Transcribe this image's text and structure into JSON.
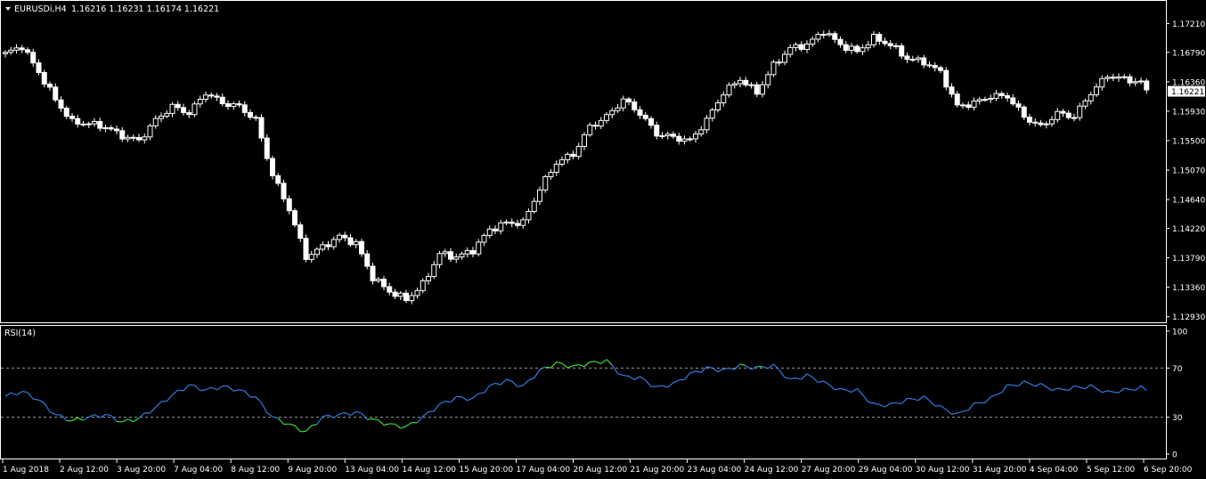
{
  "header": {
    "symbol_timeframe": "EURUSDi,H4",
    "ohlc": "1.16216 1.16231 1.16174 1.16221"
  },
  "colors": {
    "background": "#000000",
    "candle": "#ffffff",
    "grid_frame": "#ffffff",
    "rsi_line": "#2f7de1",
    "rsi_extreme": "#3ddc3d",
    "level_line": "#9a9a9a"
  },
  "chart_data": [
    {
      "type": "candlestick",
      "title": "EURUSDi,H4",
      "ylim": [
        1.129,
        1.1745
      ],
      "y_ticks": [
        "1.17210",
        "1.16790",
        "1.16360",
        "1.15930",
        "1.15500",
        "1.15070",
        "1.14640",
        "1.14220",
        "1.13790",
        "1.13360",
        "1.12930"
      ],
      "current_price_label": "1.16221",
      "x_tick_labels": [
        "1 Aug 2018",
        "2 Aug 12:00",
        "3 Aug 20:00",
        "7 Aug 04:00",
        "8 Aug 12:00",
        "9 Aug 20:00",
        "13 Aug 04:00",
        "14 Aug 12:00",
        "15 Aug 20:00",
        "17 Aug 04:00",
        "20 Aug 12:00",
        "21 Aug 20:00",
        "23 Aug 04:00",
        "24 Aug 12:00",
        "27 Aug 20:00",
        "29 Aug 04:00",
        "30 Aug 12:00",
        "31 Aug 20:00",
        "4 Sep 04:00",
        "5 Sep 12:00",
        "6 Sep 20:00"
      ],
      "anchors": [
        [
          0,
          1.1677
        ],
        [
          3,
          1.1688
        ],
        [
          6,
          1.165
        ],
        [
          9,
          1.161
        ],
        [
          12,
          1.1577
        ],
        [
          15,
          1.1575
        ],
        [
          18,
          1.157
        ],
        [
          21,
          1.1557
        ],
        [
          24,
          1.155
        ],
        [
          27,
          1.158
        ],
        [
          30,
          1.16
        ],
        [
          33,
          1.159
        ],
        [
          36,
          1.162
        ],
        [
          39,
          1.1605
        ],
        [
          42,
          1.16
        ],
        [
          45,
          1.158
        ],
        [
          48,
          1.15
        ],
        [
          51,
          1.145
        ],
        [
          54,
          1.138
        ],
        [
          57,
          1.1395
        ],
        [
          60,
          1.141
        ],
        [
          63,
          1.14
        ],
        [
          66,
          1.135
        ],
        [
          69,
          1.133
        ],
        [
          72,
          1.1318
        ],
        [
          75,
          1.134
        ],
        [
          78,
          1.1385
        ],
        [
          81,
          1.138
        ],
        [
          84,
          1.139
        ],
        [
          87,
          1.142
        ],
        [
          90,
          1.143
        ],
        [
          93,
          1.143
        ],
        [
          96,
          1.148
        ],
        [
          99,
          1.1518
        ],
        [
          102,
          1.153
        ],
        [
          105,
          1.157
        ],
        [
          108,
          1.1585
        ],
        [
          111,
          1.161
        ],
        [
          114,
          1.159
        ],
        [
          117,
          1.156
        ],
        [
          120,
          1.1555
        ],
        [
          123,
          1.155
        ],
        [
          126,
          1.158
        ],
        [
          129,
          1.162
        ],
        [
          132,
          1.164
        ],
        [
          135,
          1.162
        ],
        [
          138,
          1.166
        ],
        [
          141,
          1.1685
        ],
        [
          144,
          1.169
        ],
        [
          147,
          1.171
        ],
        [
          150,
          1.169
        ],
        [
          153,
          1.168
        ],
        [
          156,
          1.17
        ],
        [
          159,
          1.169
        ],
        [
          162,
          1.167
        ],
        [
          165,
          1.1665
        ],
        [
          168,
          1.165
        ],
        [
          171,
          1.16
        ],
        [
          174,
          1.1605
        ],
        [
          177,
          1.1615
        ],
        [
          180,
          1.1615
        ],
        [
          183,
          1.1585
        ],
        [
          186,
          1.157
        ],
        [
          189,
          1.159
        ],
        [
          192,
          1.1585
        ],
        [
          195,
          1.162
        ],
        [
          198,
          1.1645
        ],
        [
          201,
          1.164
        ],
        [
          204,
          1.1635
        ],
        [
          205,
          1.16221
        ]
      ]
    },
    {
      "type": "line",
      "title": "RSI(14)",
      "ylim": [
        0,
        100
      ],
      "y_ticks": [
        "100",
        "70",
        "30",
        "0"
      ],
      "levels": [
        70,
        30
      ],
      "anchors": [
        [
          0,
          47
        ],
        [
          3,
          51
        ],
        [
          6,
          44
        ],
        [
          9,
          32
        ],
        [
          12,
          27
        ],
        [
          15,
          30
        ],
        [
          18,
          32
        ],
        [
          21,
          26
        ],
        [
          24,
          29
        ],
        [
          27,
          38
        ],
        [
          30,
          48
        ],
        [
          33,
          56
        ],
        [
          36,
          52
        ],
        [
          39,
          55
        ],
        [
          42,
          52
        ],
        [
          45,
          46
        ],
        [
          48,
          30
        ],
        [
          51,
          24
        ],
        [
          54,
          18
        ],
        [
          57,
          30
        ],
        [
          60,
          32
        ],
        [
          63,
          34
        ],
        [
          66,
          28
        ],
        [
          69,
          24
        ],
        [
          72,
          22
        ],
        [
          75,
          30
        ],
        [
          78,
          40
        ],
        [
          81,
          46
        ],
        [
          84,
          45
        ],
        [
          87,
          55
        ],
        [
          90,
          60
        ],
        [
          93,
          55
        ],
        [
          96,
          68
        ],
        [
          99,
          74
        ],
        [
          102,
          71
        ],
        [
          105,
          74
        ],
        [
          108,
          76
        ],
        [
          111,
          63
        ],
        [
          114,
          62
        ],
        [
          117,
          54
        ],
        [
          120,
          57
        ],
        [
          123,
          65
        ],
        [
          126,
          70
        ],
        [
          129,
          68
        ],
        [
          132,
          72
        ],
        [
          135,
          70
        ],
        [
          138,
          72
        ],
        [
          141,
          60
        ],
        [
          144,
          64
        ],
        [
          147,
          58
        ],
        [
          150,
          52
        ],
        [
          153,
          52
        ],
        [
          156,
          40
        ],
        [
          159,
          40
        ],
        [
          162,
          44
        ],
        [
          165,
          46
        ],
        [
          168,
          38
        ],
        [
          171,
          32
        ],
        [
          174,
          40
        ],
        [
          177,
          45
        ],
        [
          180,
          55
        ],
        [
          183,
          58
        ],
        [
          186,
          56
        ],
        [
          189,
          52
        ],
        [
          192,
          54
        ],
        [
          195,
          55
        ],
        [
          198,
          50
        ],
        [
          201,
          52
        ],
        [
          204,
          54
        ],
        [
          205,
          52
        ]
      ]
    }
  ]
}
